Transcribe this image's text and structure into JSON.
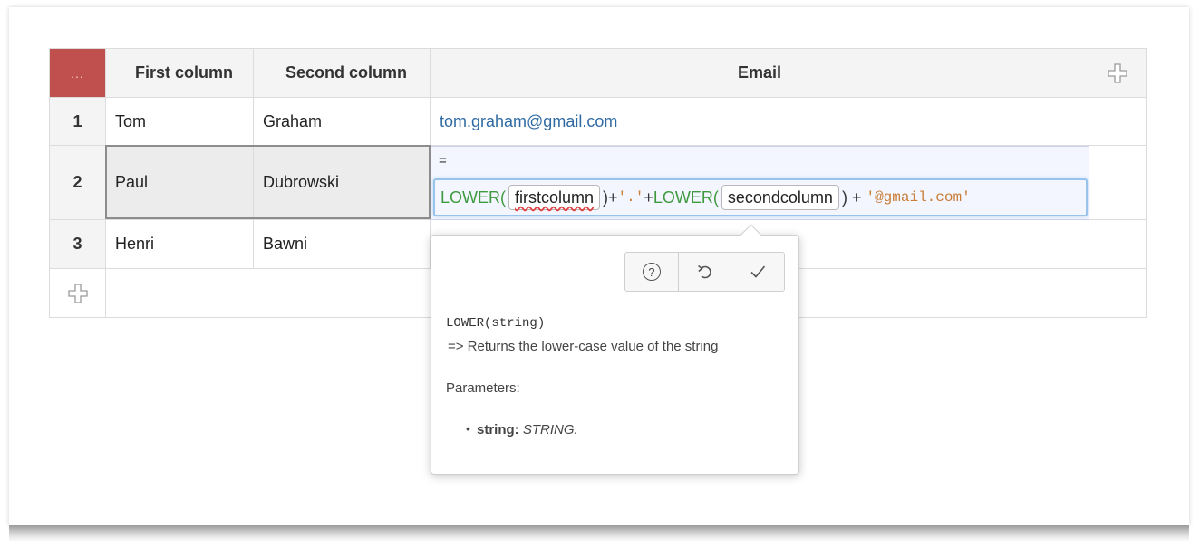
{
  "table": {
    "corner_label": "...",
    "headers": [
      "First column",
      "Second column",
      "Email"
    ],
    "rows": [
      {
        "num": "1",
        "first": "Tom",
        "second": "Graham",
        "email": "tom.graham@gmail.com"
      },
      {
        "num": "2",
        "first": "Paul",
        "second": "Dubrowski",
        "email": ""
      },
      {
        "num": "3",
        "first": "Henri",
        "second": "Bawni",
        "email": ""
      }
    ],
    "add_column_icon": "plus-icon",
    "add_row_icon": "plus-icon"
  },
  "editor": {
    "prefix": "=",
    "fn1": "LOWER(",
    "token1": "firstcolumn",
    "close1": ")+",
    "str1": "'.'",
    "plus1": "+",
    "fn2": "LOWER(",
    "token2": "secondcolumn",
    "close2": ") + ",
    "str2": "'@gmail.com'"
  },
  "popup": {
    "help_icon": "help-icon",
    "undo_icon": "undo-icon",
    "confirm_icon": "check-icon",
    "help_glyph": "?",
    "signature": "LOWER(string)",
    "description": "=> Returns the lower-case value of the string",
    "params_label": "Parameters:",
    "param_name": "string:",
    "param_type": "STRING."
  },
  "colors": {
    "corner": "#c0504d",
    "function": "#3f9a3f",
    "string_literal": "#c87d38",
    "link": "#2f6aa3",
    "editor_border": "#97c3ec"
  }
}
